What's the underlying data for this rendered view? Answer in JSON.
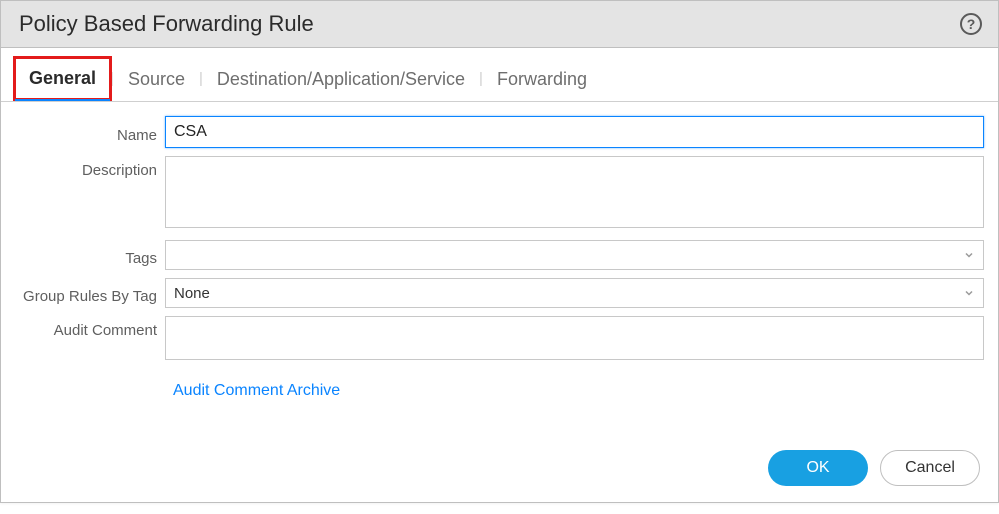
{
  "dialog": {
    "title": "Policy Based Forwarding Rule"
  },
  "tabs": {
    "general": "General",
    "source": "Source",
    "destination": "Destination/Application/Service",
    "forwarding": "Forwarding"
  },
  "labels": {
    "name": "Name",
    "description": "Description",
    "tags": "Tags",
    "groupRulesByTag": "Group Rules By Tag",
    "auditComment": "Audit Comment"
  },
  "fields": {
    "name": "CSA",
    "description": "",
    "tagsSelected": "",
    "groupRulesByTag": "None",
    "auditComment": ""
  },
  "links": {
    "auditCommentArchive": "Audit Comment Archive"
  },
  "buttons": {
    "ok": "OK",
    "cancel": "Cancel"
  }
}
